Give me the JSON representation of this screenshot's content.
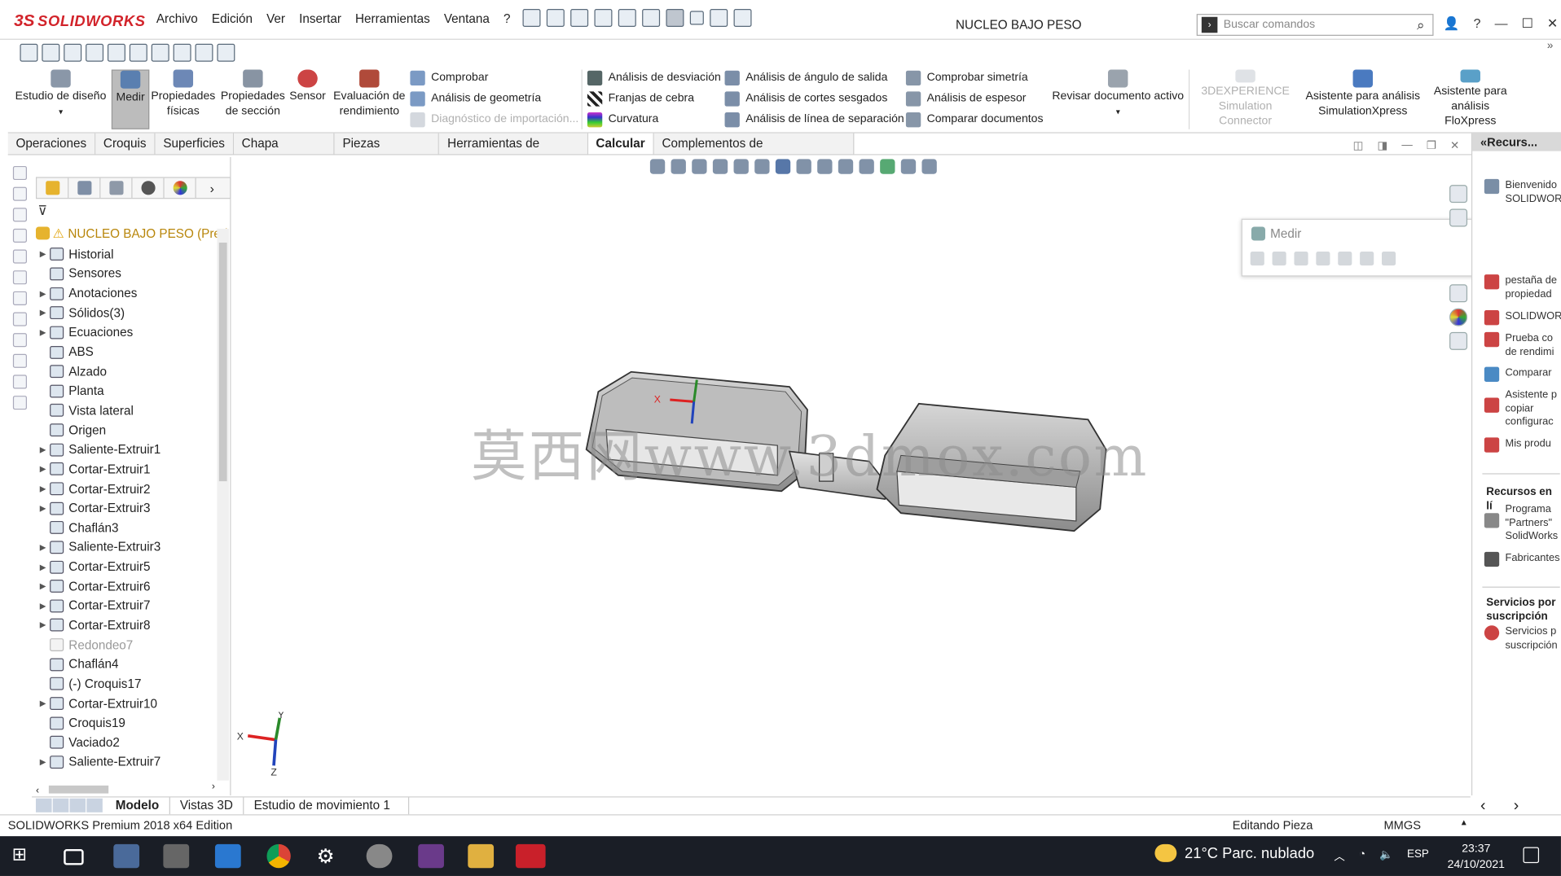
{
  "app": {
    "brand_ds": "3S",
    "brand_name": "SOLIDWORKS",
    "doc_title": "NUCLEO BAJO PESO"
  },
  "menu": [
    "Archivo",
    "Edición",
    "Ver",
    "Insertar",
    "Herramientas",
    "Ventana",
    "?"
  ],
  "search": {
    "placeholder": "Buscar comandos"
  },
  "command_manager": {
    "big": [
      {
        "label": "Estudio de diseño"
      },
      {
        "label": "Medir"
      },
      {
        "label": "Propiedades físicas"
      },
      {
        "label": "Propiedades de sección"
      },
      {
        "label": "Sensor"
      },
      {
        "label": "Evaluación de rendimiento"
      },
      {
        "label": "Revisar documento activo"
      },
      {
        "label": "3DEXPERIENCE Simulation Connector"
      },
      {
        "label": "Asistente para análisis SimulationXpress"
      },
      {
        "label": "Asistente para análisis FloXpress"
      }
    ],
    "col1": [
      "Comprobar",
      "Análisis de geometría",
      "Diagnóstico de importación..."
    ],
    "col2": [
      "Análisis de desviación",
      "Franjas de cebra",
      "Curvatura"
    ],
    "col3": [
      "Análisis de ángulo de salida",
      "Análisis de cortes sesgados",
      "Análisis de línea de separación"
    ],
    "col4": [
      "Comprobar simetría",
      "Análisis de espesor",
      "Comparar documentos"
    ]
  },
  "tabs": [
    "Operaciones",
    "Croquis",
    "Superficies",
    "Chapa metálica",
    "Piezas soldadas",
    "Herramientas de moldes",
    "Calcular",
    "Complementos de SOLIDWORKS"
  ],
  "tree": {
    "root": "NUCLEO BAJO PESO  (Pred",
    "nodes": [
      {
        "label": "Historial",
        "arrow": true
      },
      {
        "label": "Sensores",
        "arrow": false
      },
      {
        "label": "Anotaciones",
        "arrow": true
      },
      {
        "label": "Sólidos(3)",
        "arrow": true
      },
      {
        "label": "Ecuaciones",
        "arrow": true
      },
      {
        "label": "ABS",
        "arrow": false
      },
      {
        "label": "Alzado",
        "arrow": false
      },
      {
        "label": "Planta",
        "arrow": false
      },
      {
        "label": "Vista lateral",
        "arrow": false
      },
      {
        "label": "Origen",
        "arrow": false
      },
      {
        "label": "Saliente-Extruir1",
        "arrow": true
      },
      {
        "label": "Cortar-Extruir1",
        "arrow": true
      },
      {
        "label": "Cortar-Extruir2",
        "arrow": true
      },
      {
        "label": "Cortar-Extruir3",
        "arrow": true
      },
      {
        "label": "Chaflán3",
        "arrow": false
      },
      {
        "label": "Saliente-Extruir3",
        "arrow": true
      },
      {
        "label": "Cortar-Extruir5",
        "arrow": true
      },
      {
        "label": "Cortar-Extruir6",
        "arrow": true
      },
      {
        "label": "Cortar-Extruir7",
        "arrow": true
      },
      {
        "label": "Cortar-Extruir8",
        "arrow": true
      },
      {
        "label": "Redondeo7",
        "arrow": false,
        "grey": true
      },
      {
        "label": "Chaflán4",
        "arrow": false
      },
      {
        "label": "(-) Croquis17",
        "arrow": false
      },
      {
        "label": "Cortar-Extruir10",
        "arrow": true
      },
      {
        "label": "Croquis19",
        "arrow": false
      },
      {
        "label": "Vaciado2",
        "arrow": false
      },
      {
        "label": "Saliente-Extruir7",
        "arrow": true
      }
    ]
  },
  "viewport": {
    "watermark": "莫西网www.3dmox.com",
    "triad": {
      "x": "X",
      "y": "Y",
      "z": "Z"
    }
  },
  "medir_dialog": {
    "title": "Medir",
    "help": "?"
  },
  "task_pane": {
    "header": "«Recurs...",
    "items": [
      "Bienvenido SOLIDWOR",
      "pestaña de propiedad",
      "SOLIDWOR",
      "Prueba co de rendimi",
      "Comparar",
      "Asistente p copiar configurac",
      "Mis produ"
    ],
    "sec2": "Recursos en lí",
    "sec2_items": [
      "Programa \"Partners\" SolidWorks",
      "Fabricantes"
    ],
    "sec3": "Servicios por suscripción",
    "sec3_items": [
      "Servicios p suscripción"
    ]
  },
  "bottom_tabs": [
    "Modelo",
    "Vistas 3D",
    "Estudio de movimiento 1"
  ],
  "status": {
    "edition": "SOLIDWORKS Premium 2018 x64 Edition",
    "mode": "Editando Pieza",
    "units": "MMGS"
  },
  "taskbar": {
    "weather": "21°C  Parc. nublado",
    "lang": "ESP",
    "time": "23:37",
    "date": "24/10/2021"
  }
}
